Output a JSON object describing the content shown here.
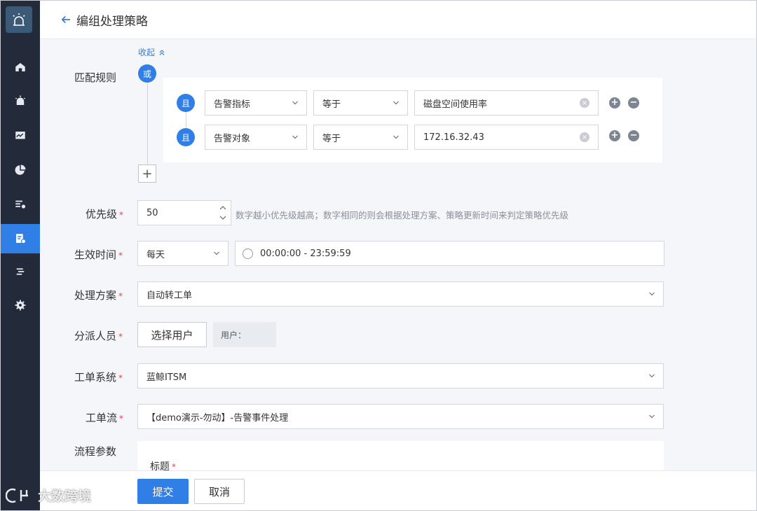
{
  "header": {
    "title": "编组处理策略"
  },
  "collapse": {
    "label": "收起"
  },
  "rules": {
    "label": "匹配规则",
    "or_badge": "或",
    "and_badge": "且",
    "rows": [
      {
        "field": "告警指标",
        "operator": "等于",
        "value": "磁盘空间使用率"
      },
      {
        "field": "告警对象",
        "operator": "等于",
        "value": "172.16.32.43"
      }
    ],
    "add_group": "+"
  },
  "priority": {
    "label": "优先级",
    "value": "50",
    "hint": "数字越小优先级越高；数字相同的则会根据处理方案、策略更新时间来判定策略优先级"
  },
  "effective_time": {
    "label": "生效时间",
    "frequency": "每天",
    "range": "00:00:00 - 23:59:59"
  },
  "solution": {
    "label": "处理方案",
    "value": "自动转工单"
  },
  "assignee": {
    "label": "分派人员",
    "button": "选择用户",
    "user_tag": "用户："
  },
  "ticket_system": {
    "label": "工单系统",
    "value": "蓝鲸ITSM"
  },
  "ticket_flow": {
    "label": "工单流",
    "value": "【demo演示-勿动】-告警事件处理"
  },
  "flow_params": {
    "label": "流程参数",
    "title_field": "标题"
  },
  "footer": {
    "submit": "提交",
    "cancel": "取消"
  },
  "watermark": {
    "text": "大数跨境"
  },
  "required_mark": "*"
}
